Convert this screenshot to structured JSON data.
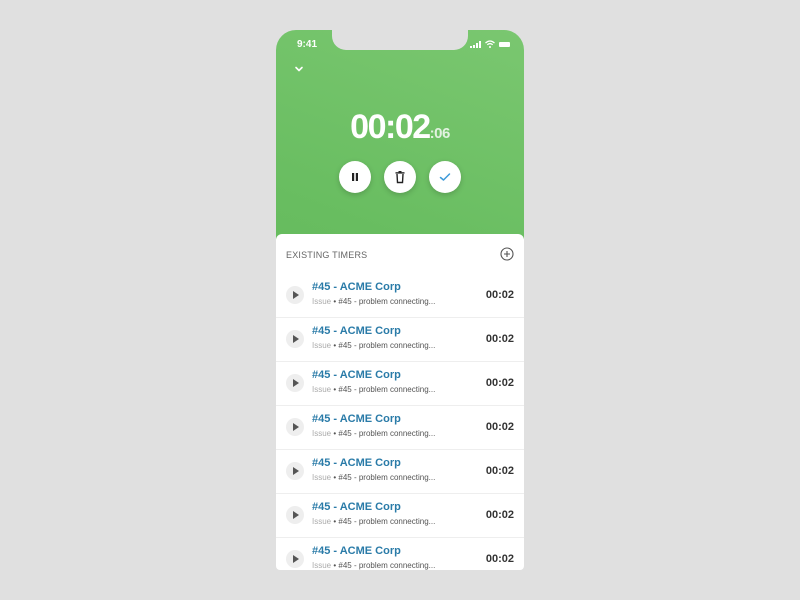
{
  "status_bar": {
    "time": "9:41",
    "icons": [
      "signal-icon",
      "wifi-icon",
      "battery-icon"
    ]
  },
  "header": {
    "collapse_icon": "chevron-down-icon"
  },
  "timer": {
    "hours_minutes": "00:02",
    "seconds": ":06"
  },
  "controls": [
    {
      "name": "pause-button",
      "icon": "pause-icon"
    },
    {
      "name": "delete-button",
      "icon": "trash-icon"
    },
    {
      "name": "complete-button",
      "icon": "check-icon"
    }
  ],
  "existing_timers": {
    "title": "EXISTING TIMERS",
    "add_icon": "plus-circle-icon",
    "items": [
      {
        "title": "#45 - ACME Corp",
        "type": "Issue",
        "separator": " • ",
        "description": "#45 - problem connecting...",
        "time": "00:02"
      },
      {
        "title": "#45 - ACME Corp",
        "type": "Issue",
        "separator": " • ",
        "description": "#45 - problem connecting...",
        "time": "00:02"
      },
      {
        "title": "#45 - ACME Corp",
        "type": "Issue",
        "separator": " • ",
        "description": "#45 - problem connecting...",
        "time": "00:02"
      },
      {
        "title": "#45 - ACME Corp",
        "type": "Issue",
        "separator": " • ",
        "description": "#45 - problem connecting...",
        "time": "00:02"
      },
      {
        "title": "#45 - ACME Corp",
        "type": "Issue",
        "separator": " • ",
        "description": "#45 - problem connecting...",
        "time": "00:02"
      },
      {
        "title": "#45 - ACME Corp",
        "type": "Issue",
        "separator": " • ",
        "description": "#45 - problem connecting...",
        "time": "00:02"
      },
      {
        "title": "#45 - ACME Corp",
        "type": "Issue",
        "separator": " • ",
        "description": "#45 - problem connecting...",
        "time": "00:02"
      }
    ]
  },
  "colors": {
    "accent_green": "#68bd60",
    "link_blue": "#2a7ba8",
    "check_blue": "#3d9ad9"
  }
}
